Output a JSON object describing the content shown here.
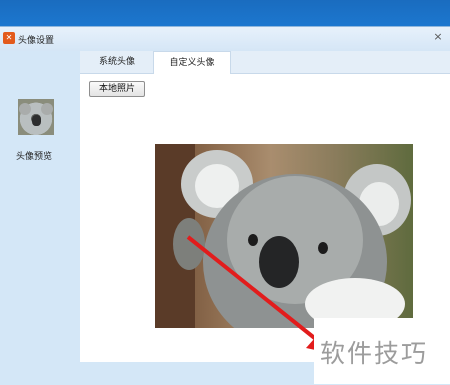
{
  "window": {
    "title": "头像设置",
    "app_icon": "app-logo-icon",
    "close_icon": "close-icon"
  },
  "sidebar": {
    "preview_label": "头像预览"
  },
  "tabs": [
    {
      "label": "系统头像",
      "selected": false
    },
    {
      "label": "自定义头像",
      "selected": true
    }
  ],
  "content": {
    "local_photo_button": "本地照片"
  },
  "watermark": {
    "text": "软件技巧"
  },
  "colors": {
    "os_bar": "#1c77cf",
    "dialog_bg": "#d4e7f7",
    "arrow": "#e21c1c"
  }
}
